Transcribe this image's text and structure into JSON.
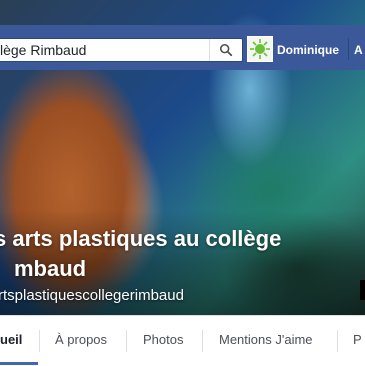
{
  "search": {
    "value": "lège Rimbaud"
  },
  "user": {
    "name": "Dominique"
  },
  "topbar": {
    "right_item": "A"
  },
  "page": {
    "title_line1": "s arts plastiques au collège",
    "title_line2": "mbaud",
    "handle": "rtsplastiquescollegerimbaud"
  },
  "tabs": [
    {
      "label": "ueil"
    },
    {
      "label": "À propos"
    },
    {
      "label": "Photos"
    },
    {
      "label": "Mentions J'aime"
    },
    {
      "label": "P"
    }
  ],
  "colors": {
    "topbar": "#3b5998",
    "tab_accent": "#4267b2"
  }
}
